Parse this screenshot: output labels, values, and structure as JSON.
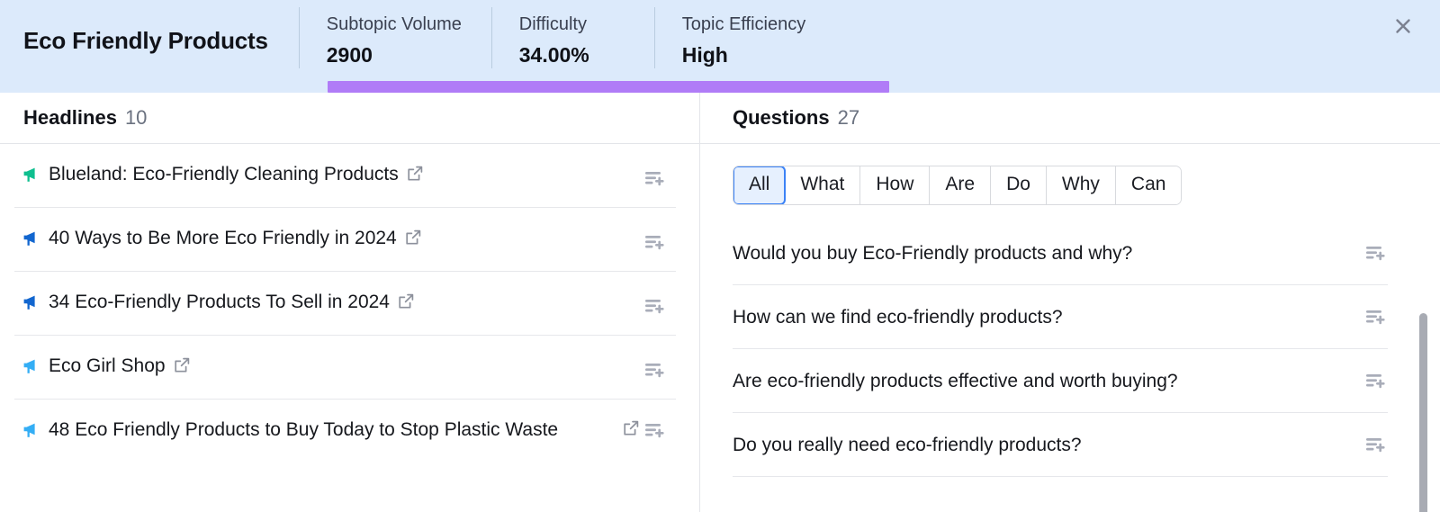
{
  "header": {
    "title": "Eco Friendly Products",
    "metrics": [
      {
        "label": "Subtopic Volume",
        "value": "2900"
      },
      {
        "label": "Difficulty",
        "value": "34.00%"
      },
      {
        "label": "Topic Efficiency",
        "value": "High"
      }
    ],
    "close_icon": "close-icon",
    "accent_bar_color": "#b07cf7",
    "background_color": "#dceafb"
  },
  "headlines_panel": {
    "title": "Headlines",
    "count": "10",
    "items": [
      {
        "text": "Blueland: Eco-Friendly Cleaning Products",
        "flag_color": "#0fbf8f",
        "flag_icon": "megaphone-icon",
        "has_external_link": true,
        "external_link_inline": true,
        "add_icon": "add-to-list-icon"
      },
      {
        "text": "40 Ways to Be More Eco Friendly in 2024",
        "flag_color": "#1266cf",
        "flag_icon": "megaphone-icon",
        "has_external_link": true,
        "external_link_inline": true,
        "add_icon": "add-to-list-icon"
      },
      {
        "text": "34 Eco-Friendly Products To Sell in 2024",
        "flag_color": "#1266cf",
        "flag_icon": "megaphone-icon",
        "has_external_link": true,
        "external_link_inline": true,
        "add_icon": "add-to-list-icon"
      },
      {
        "text": "Eco Girl Shop",
        "flag_color": "#34aef5",
        "flag_icon": "megaphone-icon",
        "has_external_link": true,
        "external_link_inline": true,
        "add_icon": "add-to-list-icon"
      },
      {
        "text": "48 Eco Friendly Products to Buy Today to Stop Plastic Waste",
        "flag_color": "#34aef5",
        "flag_icon": "megaphone-icon",
        "has_external_link": true,
        "external_link_inline": false,
        "add_icon": "add-to-list-icon"
      }
    ]
  },
  "questions_panel": {
    "title": "Questions",
    "count": "27",
    "filters": [
      {
        "label": "All",
        "active": true
      },
      {
        "label": "What",
        "active": false
      },
      {
        "label": "How",
        "active": false
      },
      {
        "label": "Are",
        "active": false
      },
      {
        "label": "Do",
        "active": false
      },
      {
        "label": "Why",
        "active": false
      },
      {
        "label": "Can",
        "active": false
      }
    ],
    "items": [
      {
        "text": "Would you buy Eco-Friendly products and why?",
        "add_icon": "add-to-list-icon"
      },
      {
        "text": "How can we find eco-friendly products?",
        "add_icon": "add-to-list-icon"
      },
      {
        "text": "Are eco-friendly products effective and worth buying?",
        "add_icon": "add-to-list-icon"
      },
      {
        "text": "Do you really need eco-friendly products?",
        "add_icon": "add-to-list-icon"
      }
    ],
    "scrollbar": "vertical-scrollbar"
  }
}
